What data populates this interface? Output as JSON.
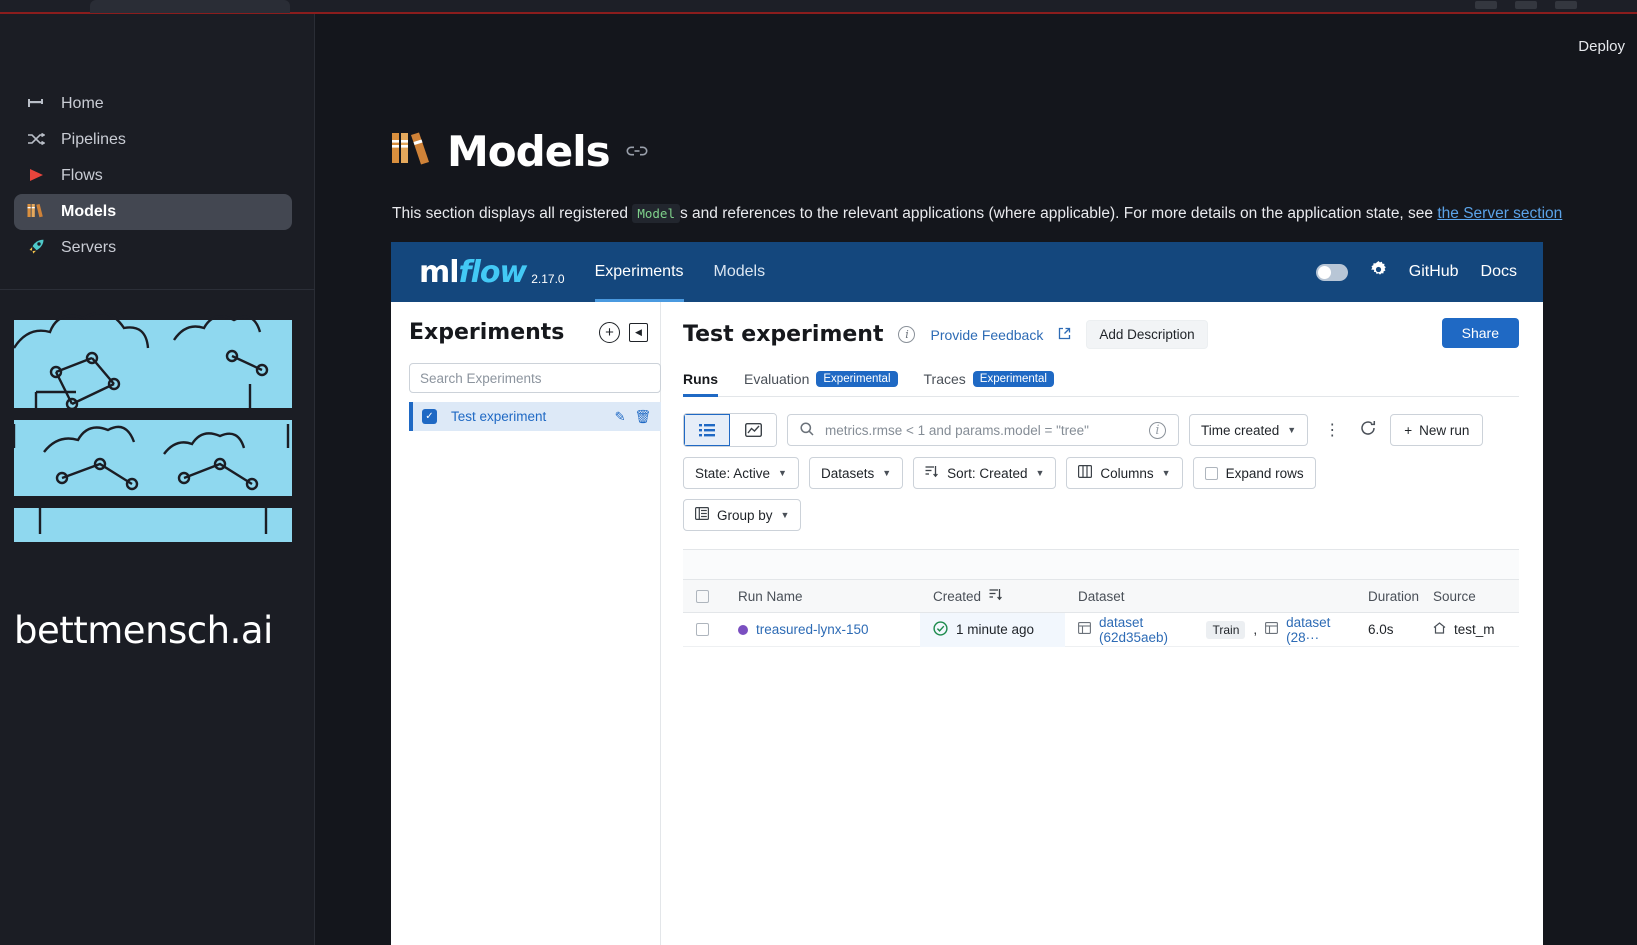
{
  "sidebar": {
    "items": [
      {
        "label": "Home",
        "icon": "home-icon",
        "glyph": "─■",
        "active": false
      },
      {
        "label": "Pipelines",
        "icon": "pipelines-icon",
        "glyph": "⤨",
        "active": false
      },
      {
        "label": "Flows",
        "icon": "flows-icon",
        "glyph": "▶",
        "active": false
      },
      {
        "label": "Models",
        "icon": "books-icon",
        "glyph": "📚",
        "active": true
      },
      {
        "label": "Servers",
        "icon": "rocket-icon",
        "glyph": "🚀",
        "active": false
      }
    ],
    "brand_name": "bettmensch.ai"
  },
  "topbar": {
    "deploy_label": "Deploy"
  },
  "page": {
    "title": "Models",
    "title_icon": "books-icon",
    "anchor_icon": "link-icon",
    "description_part1": "This section displays all registered ",
    "description_code": "Model",
    "description_part2": "s and references to the relevant applications (where applicable). For more details on the application state, see ",
    "description_link": "the Server section"
  },
  "mlflow": {
    "logo_ml": "ml",
    "logo_flow": "flow",
    "version": "2.17.0",
    "nav": [
      {
        "label": "Experiments",
        "active": true
      },
      {
        "label": "Models",
        "active": false
      }
    ],
    "dark_toggle": "theme-toggle",
    "gear": "gear-icon",
    "github_label": "GitHub",
    "docs_label": "Docs",
    "accent_color": "#14477d"
  },
  "experiments": {
    "title": "Experiments",
    "add_icon": "plus-circle-icon",
    "collapse_icon": "collapse-panel-icon",
    "search_placeholder": "Search Experiments",
    "search_value": "",
    "items": [
      {
        "name": "Test experiment",
        "selected": true,
        "edit_icon": "pencil-icon",
        "delete_icon": "trash-icon"
      }
    ]
  },
  "runs": {
    "title": "Test experiment",
    "info_icon": "info-icon",
    "provide_feedback": "Provide Feedback",
    "external_link_icon": "external-link-icon",
    "add_description": "Add Description",
    "share_label": "Share",
    "tabs": [
      {
        "label": "Runs",
        "badge": "",
        "active": true
      },
      {
        "label": "Evaluation",
        "badge": "Experimental",
        "active": false
      },
      {
        "label": "Traces",
        "badge": "Experimental",
        "active": false
      }
    ],
    "view_toggle": [
      {
        "icon": "list-view-icon",
        "glyph": "☰",
        "active": true
      },
      {
        "icon": "chart-view-icon",
        "glyph": "📈",
        "active": false
      }
    ],
    "search": {
      "icon": "search-icon",
      "value": "metrics.rmse < 1 and params.model = \"tree\"",
      "info_icon": "info-icon"
    },
    "time_created_label": "Time created",
    "kebab_icon": "more-options-icon",
    "refresh_icon": "refresh-icon",
    "new_run_label": "New run",
    "filters": [
      {
        "label": "State: Active",
        "icon": "",
        "caret": true
      },
      {
        "label": "Datasets",
        "icon": "",
        "caret": true
      },
      {
        "label": "Sort: Created",
        "icon": "sort-icon",
        "caret": true
      },
      {
        "label": "Columns",
        "icon": "columns-icon",
        "caret": true
      }
    ],
    "expand_rows_label": "Expand rows",
    "group_by_label": "Group by",
    "group_by_icon": "group-icon",
    "table": {
      "columns": [
        "Run Name",
        "Created",
        "Dataset",
        "Duration",
        "Source"
      ],
      "created_sort_icon": "sort-desc-icon",
      "rows": [
        {
          "run_name": "treasured-lynx-150",
          "run_dot_color": "#7a4fc0",
          "created": "1 minute ago",
          "created_status_icon": "check-circle-icon",
          "dataset_1": "dataset (62d35aeb)",
          "dataset_1_tag": "Train",
          "dataset_separator": ",",
          "dataset_2": "dataset (28···",
          "duration": "6.0s",
          "source": "test_m",
          "source_icon": "home-icon"
        }
      ]
    }
  }
}
